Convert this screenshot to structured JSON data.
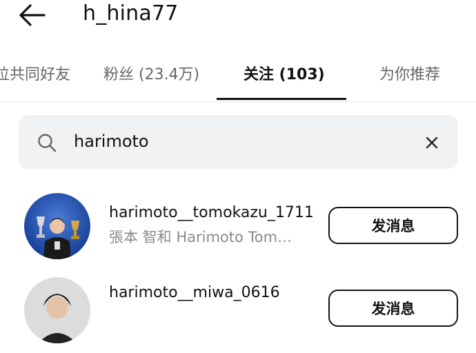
{
  "header": {
    "back_icon": "arrow-left-icon",
    "username": "h_hina77"
  },
  "tabs": [
    {
      "label": "位共同好友",
      "active": false
    },
    {
      "label": "粉丝 (23.4万)",
      "active": false
    },
    {
      "label": "关注 (103)",
      "active": true
    },
    {
      "label": "为你推荐",
      "active": false
    }
  ],
  "search": {
    "icon": "search-icon",
    "value": "harimoto",
    "clear_icon": "close-icon"
  },
  "results": [
    {
      "handle": "harimoto__tomokazu_1711",
      "fullname": "張本 智和 Harimoto Tom…",
      "button": "发消息"
    },
    {
      "handle": "harimoto__miwa_0616",
      "fullname": "",
      "button": "发消息"
    }
  ]
}
